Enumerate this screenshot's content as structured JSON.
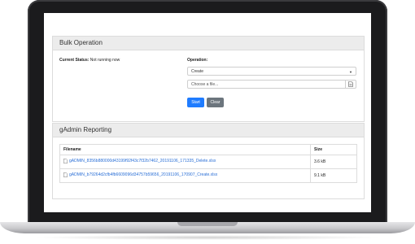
{
  "bulk_operation": {
    "title": "Bulk Operation",
    "status_label": "Current Status:",
    "status_value": "Not running now",
    "operation_label": "Operation:",
    "operation_selected": "Create",
    "file_placeholder": "Choose a file...",
    "start_label": "Start",
    "clear_label": "Clear"
  },
  "reporting": {
    "title": "gAdmin Reporting",
    "columns": [
      "Filename",
      "Size"
    ],
    "rows": [
      {
        "filename": "gADMIN_8356b880000d43199f92f43c7f32b7462_20191106_171335_Delete.xlsx",
        "size": "3.6 kB"
      },
      {
        "filename": "gADMIN_b79264d2cfb4fb6609096d34757b59656_20191106_170907_Create.xlsx",
        "size": "9.1 kB"
      }
    ]
  },
  "colors": {
    "primary": "#1f7cff",
    "secondary": "#6c757d",
    "link": "#2a6fd6",
    "header_bg": "#ececec"
  }
}
